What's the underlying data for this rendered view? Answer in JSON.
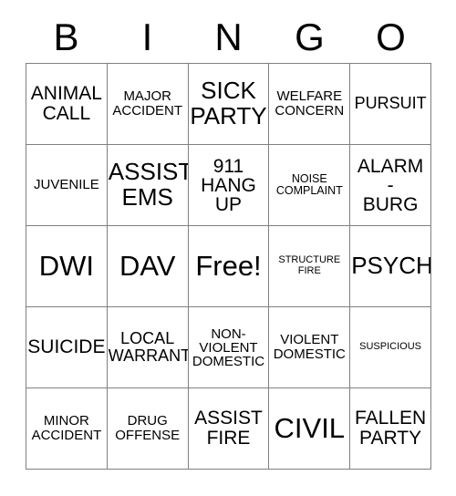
{
  "card": {
    "title_letters": [
      "B",
      "I",
      "N",
      "G",
      "O"
    ],
    "free_space_label": "Free!",
    "grid_rows": [
      [
        {
          "label": "ANIMAL\nCALL",
          "size": "xl"
        },
        {
          "label": "MAJOR\nACCIDENT",
          "size": "md"
        },
        {
          "label": "SICK\nPARTY",
          "size": "xxl"
        },
        {
          "label": "WELFARE\nCONCERN",
          "size": "md"
        },
        {
          "label": "PURSUIT",
          "size": "lg"
        }
      ],
      [
        {
          "label": "JUVENILE",
          "size": "md"
        },
        {
          "label": "ASSIST\nEMS",
          "size": "xxl"
        },
        {
          "label": "911\nHANG\nUP",
          "size": "xl"
        },
        {
          "label": "NOISE\nCOMPLAINT",
          "size": "sm"
        },
        {
          "label": "ALARM\n-\nBURG",
          "size": "xl"
        }
      ],
      [
        {
          "label": "DWI",
          "size": "huge"
        },
        {
          "label": "DAV",
          "size": "huge"
        },
        {
          "label": "Free!",
          "size": "huge"
        },
        {
          "label": "STRUCTURE\nFIRE",
          "size": "xs"
        },
        {
          "label": "PSYCH",
          "size": "xxl"
        }
      ],
      [
        {
          "label": "SUICIDE",
          "size": "xl"
        },
        {
          "label": "LOCAL\nWARRANT",
          "size": "lg"
        },
        {
          "label": "NON-\nVIOLENT\nDOMESTIC",
          "size": "md"
        },
        {
          "label": "VIOLENT\nDOMESTIC",
          "size": "md"
        },
        {
          "label": "SUSPICIOUS",
          "size": "xs"
        }
      ],
      [
        {
          "label": "MINOR\nACCIDENT",
          "size": "md"
        },
        {
          "label": "DRUG\nOFFENSE",
          "size": "md"
        },
        {
          "label": "ASSIST\nFIRE",
          "size": "xl"
        },
        {
          "label": "CIVIL",
          "size": "huge"
        },
        {
          "label": "FALLEN\nPARTY",
          "size": "xl"
        }
      ]
    ]
  },
  "colors": {
    "border": "#808080",
    "text": "#000000",
    "background": "#ffffff"
  }
}
